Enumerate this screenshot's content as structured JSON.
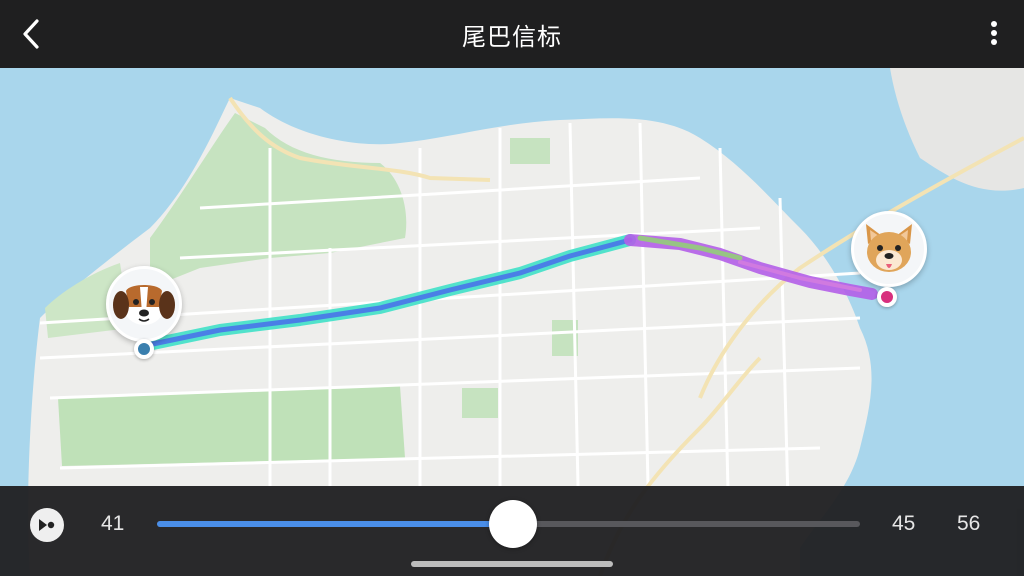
{
  "header": {
    "title": "尾巴信标",
    "back_icon": "chevron-left-icon",
    "more_icon": "more-vertical-icon"
  },
  "map": {
    "route_colors": [
      "#3fe0c8",
      "#4a7fe6",
      "#b35ee8",
      "#8ed96a"
    ],
    "start_marker": {
      "avatar": "beagle-dog-icon",
      "pin_color": "#3a7fae"
    },
    "end_marker": {
      "avatar": "shiba-dog-icon",
      "pin_color": "#d8307e"
    }
  },
  "playback": {
    "play_icon": "play-pause-icon",
    "start_time": "41",
    "current_time": "45",
    "end_time": "56",
    "progress": 0.506,
    "fill_color": "#4a8ee8"
  }
}
